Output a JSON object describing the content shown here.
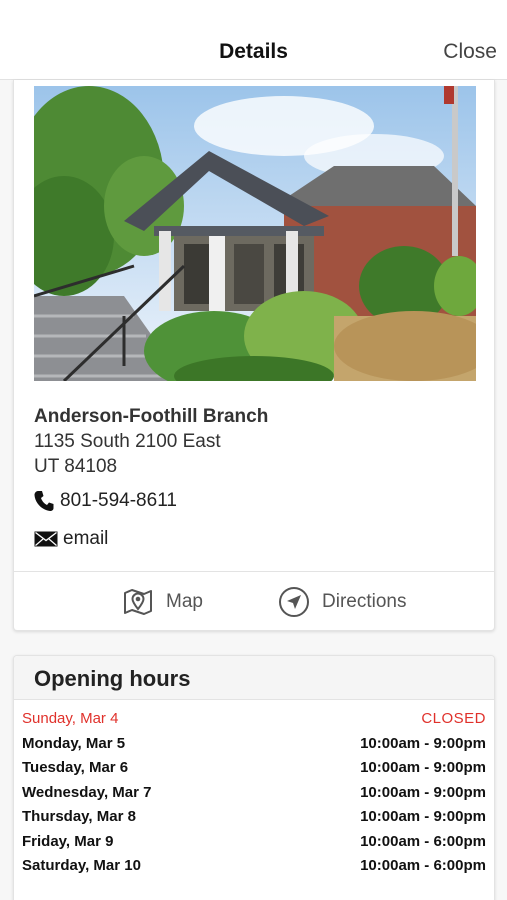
{
  "nav": {
    "title": "Details",
    "close_label": "Close"
  },
  "branch": {
    "name": "Anderson-Foothill Branch",
    "address_line1": "1135 South 2100 East",
    "address_line2": "UT 84108",
    "phone": "801-594-8611",
    "email_label": "email",
    "photo_subject": "library-branch-building-photo"
  },
  "actions": {
    "map_label": "Map",
    "map_icon": "map-pin-icon",
    "directions_label": "Directions",
    "directions_icon": "navigation-arrow-icon"
  },
  "hours": {
    "title": "Opening hours",
    "rows": [
      {
        "day": "Sunday, Mar 4",
        "time": "CLOSED",
        "today": true
      },
      {
        "day": "Monday, Mar 5",
        "time": "10:00am - 9:00pm",
        "today": false
      },
      {
        "day": "Tuesday, Mar 6",
        "time": "10:00am - 9:00pm",
        "today": false
      },
      {
        "day": "Wednesday, Mar 7",
        "time": "10:00am - 9:00pm",
        "today": false
      },
      {
        "day": "Thursday, Mar 8",
        "time": "10:00am - 9:00pm",
        "today": false
      },
      {
        "day": "Friday, Mar 9",
        "time": "10:00am - 6:00pm",
        "today": false
      },
      {
        "day": "Saturday, Mar 10",
        "time": "10:00am - 6:00pm",
        "today": false
      }
    ]
  },
  "colors": {
    "accent_red": "#e0312b",
    "text": "#222222",
    "muted": "#555555"
  }
}
